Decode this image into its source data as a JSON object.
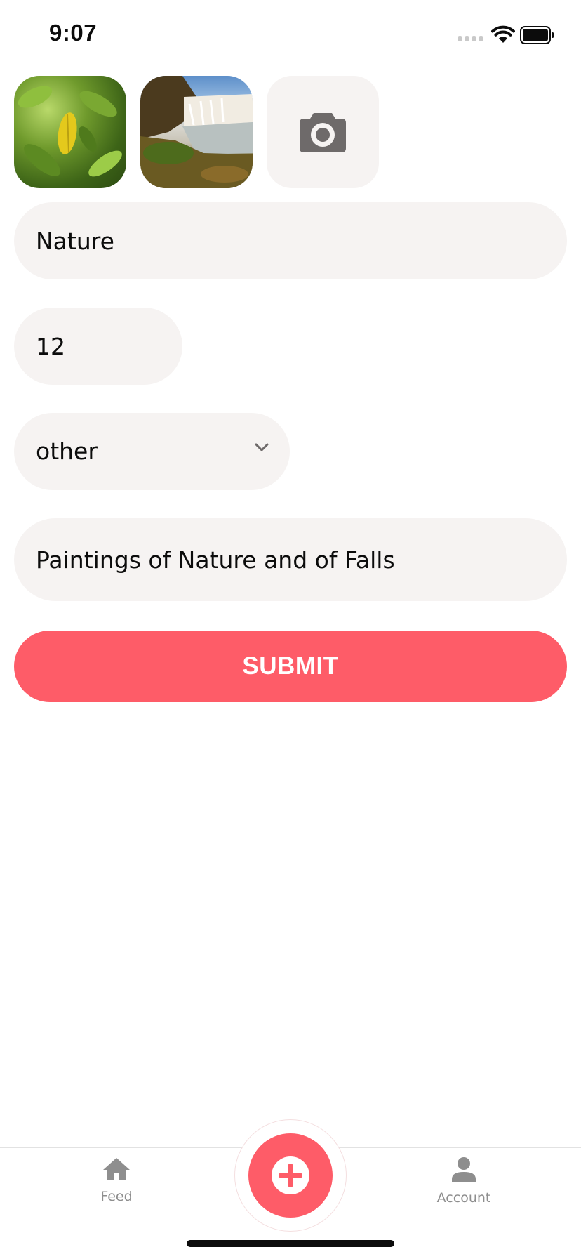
{
  "status_bar": {
    "time": "9:07",
    "signal_icon": "cellular-signal-icon",
    "wifi_icon": "wifi-icon",
    "battery_icon": "battery-icon"
  },
  "photos": [
    {
      "icon": "photo-thumbnail",
      "subject": "leaves"
    },
    {
      "icon": "photo-thumbnail",
      "subject": "waterfall"
    }
  ],
  "add_photo": {
    "icon": "camera-icon"
  },
  "form": {
    "title_value": "Nature",
    "count_value": "12",
    "category_value": "other",
    "description_value": "Paintings of Nature and of Falls",
    "submit_label": "SUBMIT"
  },
  "tab_bar": {
    "feed_label": "Feed",
    "feed_icon": "home-icon",
    "add_icon": "plus-icon",
    "account_label": "Account",
    "account_icon": "person-icon"
  },
  "colors": {
    "accent": "#fe5c68",
    "field_background": "#f6f3f2",
    "tab_inactive": "#8e8e8e",
    "camera_icon": "#6e6a6a"
  }
}
